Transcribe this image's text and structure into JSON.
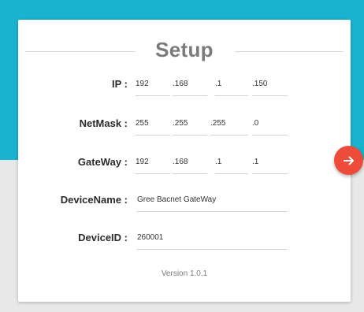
{
  "header": {
    "title": "Setup"
  },
  "fields": {
    "ip": {
      "label": "IP :",
      "octets": [
        "192",
        ".168",
        ".1",
        ".150"
      ]
    },
    "netmask": {
      "label": "NetMask :",
      "octets": [
        "255",
        ".255",
        ".255",
        ".0"
      ]
    },
    "gateway": {
      "label": "GateWay :",
      "octets": [
        "192",
        ".168",
        ".1",
        ".1"
      ]
    },
    "device_name": {
      "label": "DeviceName :",
      "value": "Gree Bacnet GateWay"
    },
    "device_id": {
      "label": "DeviceID :",
      "value": "260001"
    }
  },
  "footer": {
    "version": "Version 1.0.1"
  },
  "next_button": {
    "icon": "arrow-right-icon"
  },
  "colors": {
    "header_band": "#1ab3cf",
    "background": "#e8e8e8",
    "fab": "#ef4b3a",
    "title": "#7b7b7b"
  }
}
